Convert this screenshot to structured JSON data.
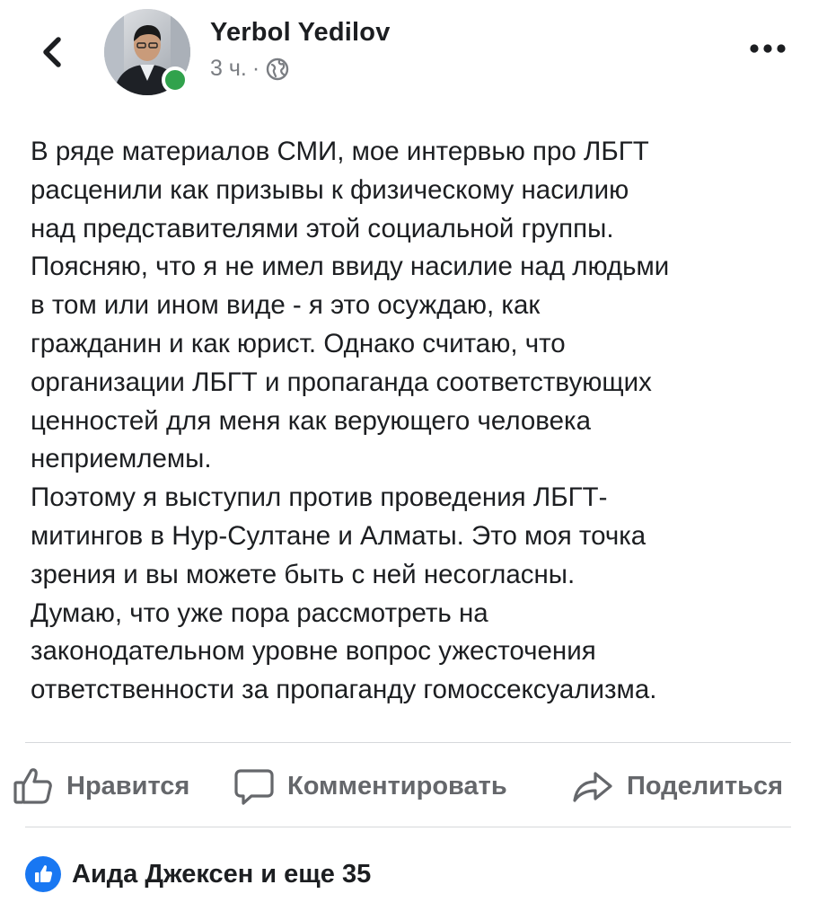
{
  "header": {
    "author_name": "Yerbol Yedilov",
    "time": "3 ч.",
    "separator": "·",
    "privacy_icon": "globe-icon",
    "back_icon": "chevron-left-icon",
    "more_icon": "more-dots-icon",
    "online_status_color": "#31a24c"
  },
  "post": {
    "text": "В ряде материалов СМИ, мое интервью про ЛБГТ\nрасценили как призывы к физическому насилию\nнад представителями этой социальной группы.\nПоясняю, что я не имел ввиду насилие над людьми\nв том или ином виде - я это осуждаю, как\nгражданин и как юрист. Однако считаю, что\nорганизации ЛБГТ и пропаганда соответствующих\nценностей для меня как верующего человека\nнеприемлемы.\nПоэтому я выступил против проведения ЛБГТ-\nмитингов в Нур-Султане и Алматы. Это моя точка\nзрения и вы можете быть с ней несогласны.\nДумаю, что уже пора рассмотреть на\nзаконодательном уровне вопрос ужесточения\nответственности за пропаганду гомоссексуализма."
  },
  "actions": {
    "like_label": "Нравится",
    "comment_label": "Комментировать",
    "share_label": "Поделиться",
    "like_icon": "thumbs-up-icon",
    "comment_icon": "comment-bubble-icon",
    "share_icon": "share-arrow-icon",
    "label_color": "#65676b"
  },
  "reactions": {
    "summary": "Аида Джексен и еще 35",
    "badge_icon": "like-badge-icon",
    "badge_color": "#1877f2"
  }
}
